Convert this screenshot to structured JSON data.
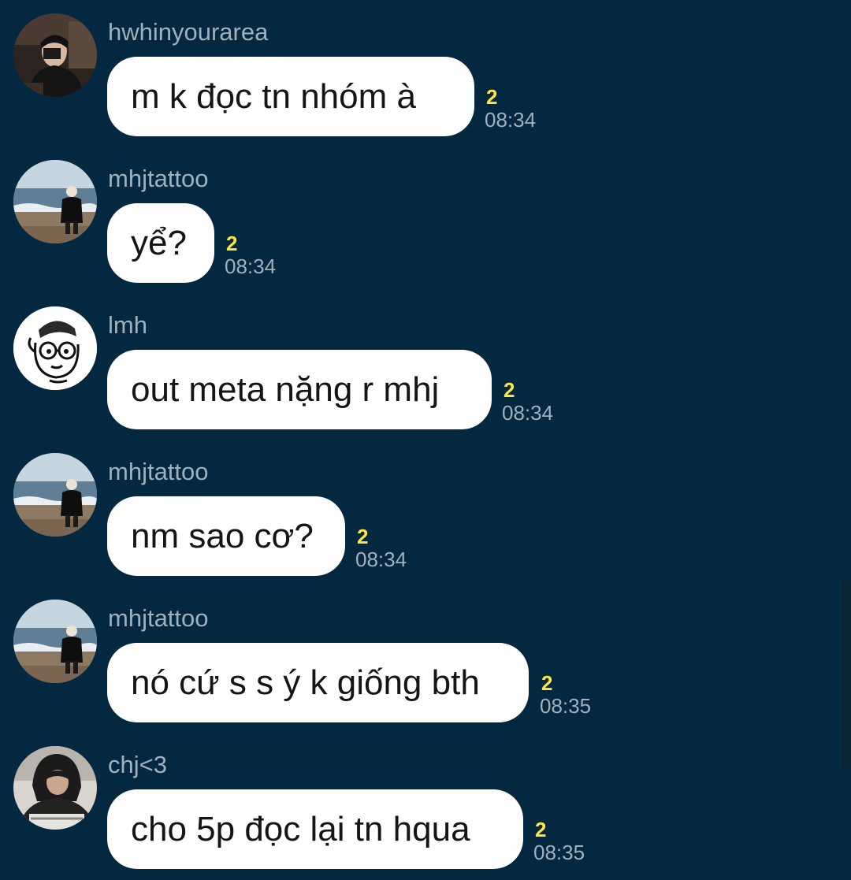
{
  "messages": [
    {
      "sender": "hwhinyourarea",
      "text": "m k đọc tn nhóm à",
      "unread": "2",
      "time": "08:34",
      "avatar": "man-camera-photo"
    },
    {
      "sender": "mhjtattoo",
      "text": "yể?",
      "unread": "2",
      "time": "08:34",
      "avatar": "beach-person-photo"
    },
    {
      "sender": "lmh",
      "text": "out meta nặng r mhj",
      "unread": "2",
      "time": "08:34",
      "avatar": "cartoon-face-drawing"
    },
    {
      "sender": "mhjtattoo",
      "text": "nm sao cơ?",
      "unread": "2",
      "time": "08:34",
      "avatar": "beach-person-photo"
    },
    {
      "sender": "mhjtattoo",
      "text": "nó cứ s s ý k giống bth",
      "unread": "2",
      "time": "08:35",
      "avatar": "beach-person-photo"
    },
    {
      "sender": "chj<3",
      "text": "cho 5p đọc lại tn hqua",
      "unread": "2",
      "time": "08:35",
      "avatar": "hooded-person-photo"
    }
  ],
  "colors": {
    "background": "#04283f",
    "bubble": "#ffffff",
    "unread_badge": "#ffe641",
    "secondary_text": "#9fb1bd"
  }
}
